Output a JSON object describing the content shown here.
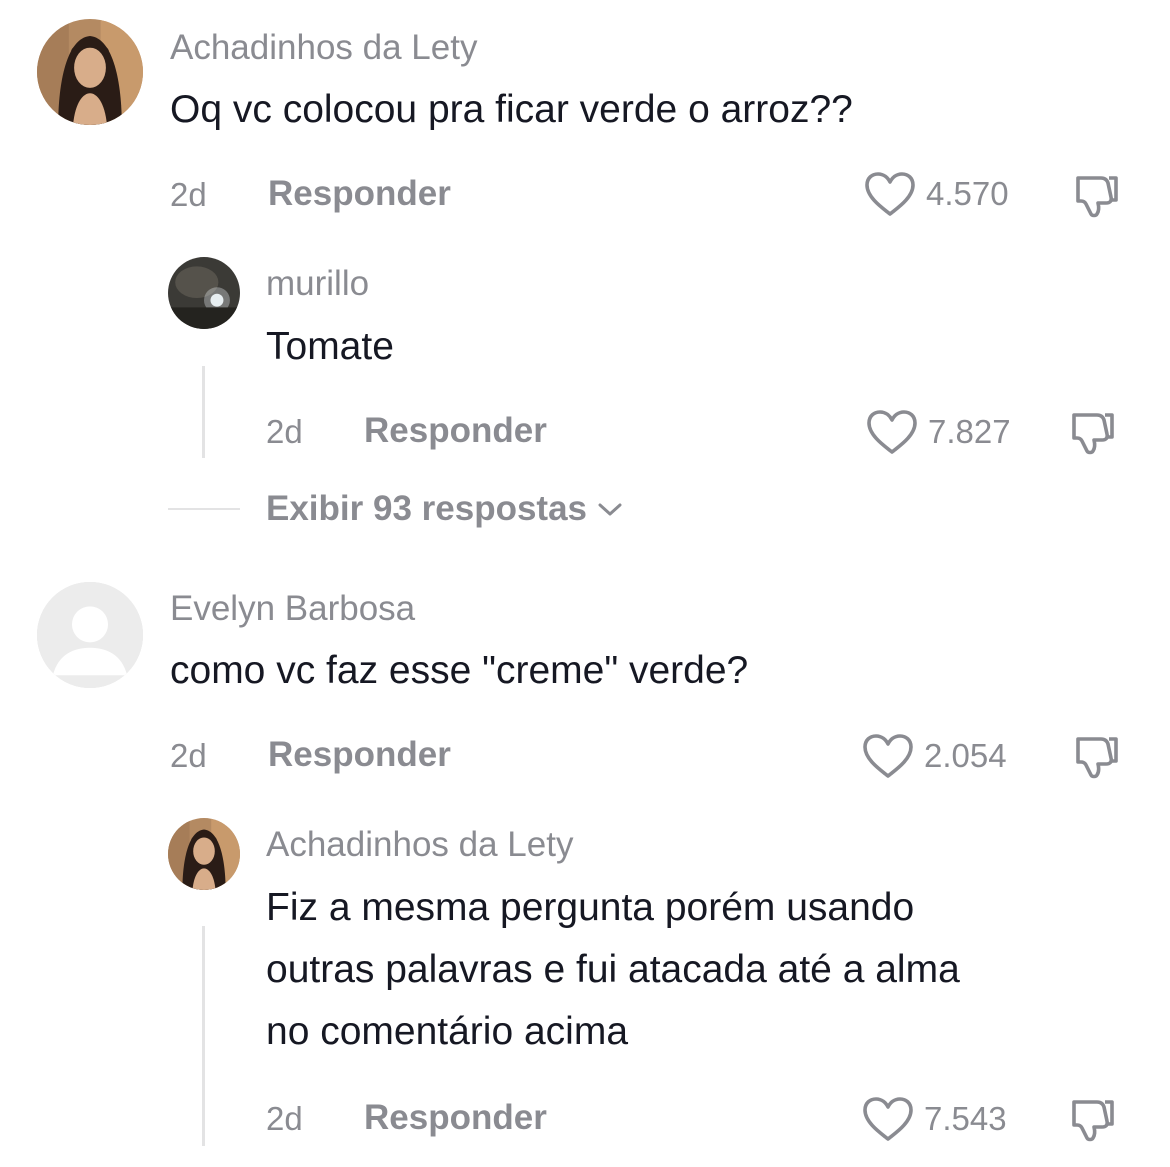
{
  "comments": [
    {
      "username": "Achadinhos da Lety",
      "text": "Oq vc colocou pra ficar verde o arroz??",
      "time": "2d",
      "reply_label": "Responder",
      "likes": "4.570",
      "avatar": "woman-photo-avatar",
      "replies": [
        {
          "username": "murillo",
          "text": "Tomate",
          "time": "2d",
          "reply_label": "Responder",
          "likes": "7.827",
          "avatar": "dark-photo-avatar"
        }
      ],
      "view_replies_label": "Exibir 93 respostas"
    },
    {
      "username": "Evelyn Barbosa",
      "text": "como vc faz esse \"creme\" verde?",
      "time": "2d",
      "reply_label": "Responder",
      "likes": "2.054",
      "avatar": "default-user-avatar",
      "replies": [
        {
          "username": "Achadinhos da Lety",
          "text_lines": [
            "Fiz a mesma pergunta porém usando",
            "outras palavras e fui atacada até a alma",
            "no comentário acima"
          ],
          "time": "2d",
          "reply_label": "Responder",
          "likes": "7.543",
          "avatar": "woman-photo-avatar"
        }
      ]
    }
  ],
  "colors": {
    "primary_text": "#161823",
    "secondary_text": "#8a8b91",
    "divider": "#e3e3e4",
    "background": "#ffffff"
  },
  "icons": [
    "heart-outline-icon",
    "thumbs-down-icon",
    "chevron-down-icon"
  ]
}
